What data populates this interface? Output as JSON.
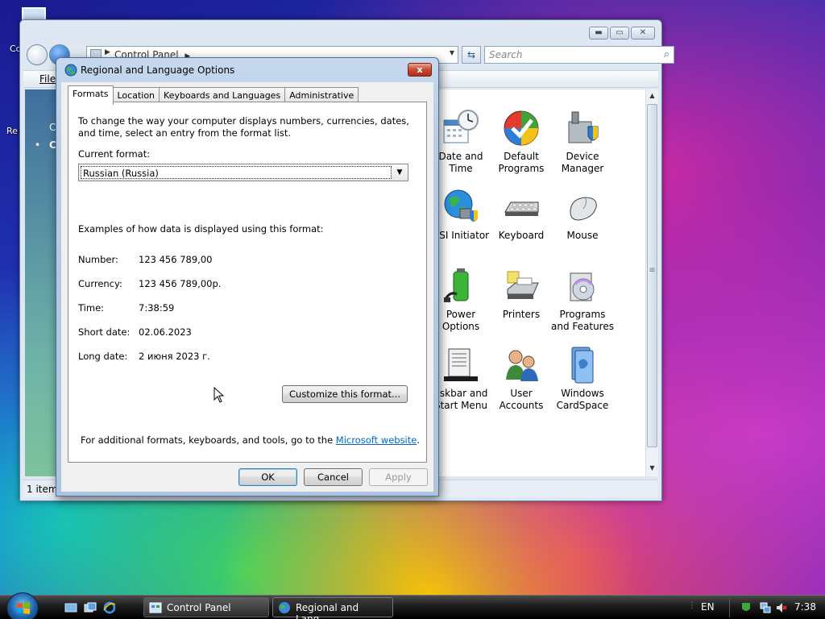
{
  "desktop": {
    "icon1_label": "Co",
    "icon2_label": "Re"
  },
  "control_panel": {
    "address": "Control Panel",
    "search_placeholder": "Search",
    "menu_file": "File",
    "status": "1 item",
    "sidebar_text_1": "C",
    "sidebar_text_2": "C",
    "items": [
      {
        "label": "Date and Time"
      },
      {
        "label": "Default Programs"
      },
      {
        "label": "Device Manager"
      },
      {
        "label": "CSI Initiator"
      },
      {
        "label": "Keyboard"
      },
      {
        "label": "Mouse"
      },
      {
        "label": "Power Options"
      },
      {
        "label": "Printers"
      },
      {
        "label": "Programs and Features"
      },
      {
        "label": "askbar and Start Menu"
      },
      {
        "label": "User Accounts"
      },
      {
        "label": "Windows CardSpace"
      }
    ]
  },
  "dialog": {
    "title": "Regional and Language Options",
    "close_glyph": "x",
    "tabs": [
      "Formats",
      "Location",
      "Keyboards and Languages",
      "Administrative"
    ],
    "intro": "To change the way your computer displays numbers, currencies, dates, and time, select an entry from the format list.",
    "current_format_label": "Current format:",
    "current_format_value": "Russian (Russia)",
    "examples_label": "Examples of how data is displayed using this format:",
    "examples": [
      {
        "key": "Number:",
        "value": "123 456 789,00"
      },
      {
        "key": "Currency:",
        "value": "123 456 789,00р."
      },
      {
        "key": "Time:",
        "value": "7:38:59"
      },
      {
        "key": "Short date:",
        "value": "02.06.2023"
      },
      {
        "key": "Long date:",
        "value": "2 июня 2023 г."
      }
    ],
    "customize_button": "Customize this format...",
    "footer_text": "For additional formats, keyboards, and tools, go to the ",
    "footer_link": "Microsoft website",
    "footer_end": ".",
    "ok_button": "OK",
    "cancel_button": "Cancel",
    "apply_button": "Apply"
  },
  "taskbar": {
    "tasks": [
      "Control Panel",
      "Regional and Lang..."
    ],
    "language": "EN",
    "clock": "7:38"
  },
  "colors": {
    "link": "#0066cc",
    "dialog_frame": "#aec4de",
    "close_red": "#c44b32"
  }
}
